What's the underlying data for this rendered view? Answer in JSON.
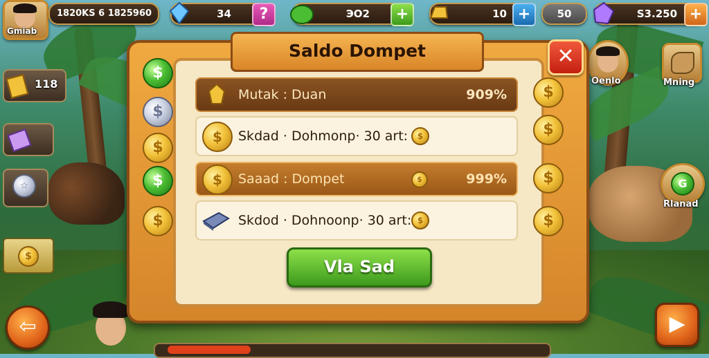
{
  "topbar": {
    "player_name": "Gmiab",
    "score": "1820KS 6 1825960",
    "gems": "34",
    "green_resource": "ЭО2",
    "gold": "10",
    "energy": "50",
    "crystals": "S3.250"
  },
  "left_sidebar": {
    "tile1_value": "118"
  },
  "right_sidebar": {
    "friend_name": "Oenlo",
    "map_label": "Mning",
    "guild_label": "Rlanad"
  },
  "dialog": {
    "title": "Saldo Dompet",
    "close_symbol": "✕",
    "rows": [
      {
        "text": "Mutak : Duan",
        "value": "909%"
      },
      {
        "text": "Skdad · Dohmonp· 30 art:",
        "value": ""
      },
      {
        "text": "Saaad : Dompet",
        "value": "999%"
      },
      {
        "text": "Skdod · Dohnoonp· 30 art:",
        "value": ""
      }
    ],
    "action_button": "Vla Sad"
  },
  "colors": {
    "panel": "#e99a36",
    "accent_green": "#4bbd33",
    "close_red": "#d8291a",
    "gold": "#f2c23a"
  }
}
